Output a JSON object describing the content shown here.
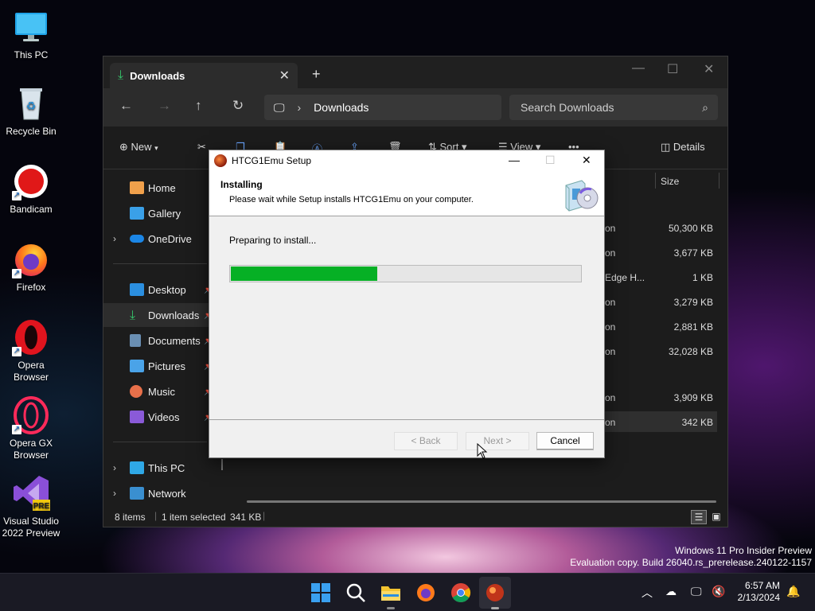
{
  "desktop": {
    "icons": [
      {
        "label": "This PC"
      },
      {
        "label": "Recycle Bin"
      },
      {
        "label": "Bandicam"
      },
      {
        "label": "Firefox"
      },
      {
        "label": "Opera Browser"
      },
      {
        "label": "Opera GX Browser"
      },
      {
        "label": "Visual Studio 2022 Preview",
        "badge": "PRE"
      }
    ]
  },
  "explorer": {
    "tab_label": "Downloads",
    "tab_close": "✕",
    "new_tab": "+",
    "breadcrumb": "Downloads",
    "search_placeholder": "Search Downloads",
    "toolbar": {
      "new_label": "New",
      "sort_label": "Sort",
      "view_label": "View",
      "more": "•••",
      "details_label": "Details"
    },
    "sidebar": {
      "items": [
        {
          "label": "Home"
        },
        {
          "label": "Gallery"
        },
        {
          "label": "OneDrive"
        },
        {
          "label": "Desktop"
        },
        {
          "label": "Downloads"
        },
        {
          "label": "Documents"
        },
        {
          "label": "Pictures"
        },
        {
          "label": "Music"
        },
        {
          "label": "Videos"
        },
        {
          "label": "This PC"
        },
        {
          "label": "Network"
        }
      ]
    },
    "columns": {
      "size": "Size"
    },
    "rows": [
      {
        "frag": "on",
        "size": "50,300 KB"
      },
      {
        "frag": "on",
        "size": "3,677 KB"
      },
      {
        "frag": "Edge H...",
        "size": "1 KB"
      },
      {
        "frag": "on",
        "size": "3,279 KB"
      },
      {
        "frag": "on",
        "size": "2,881 KB"
      },
      {
        "frag": "on",
        "size": "32,028 KB"
      },
      {
        "frag": "on",
        "size": "3,909 KB"
      },
      {
        "frag": "on",
        "size": "342 KB"
      }
    ],
    "status": {
      "items": "8 items",
      "selected": "1 item selected",
      "size": "341 KB"
    }
  },
  "setup": {
    "title": "HTCG1Emu Setup",
    "heading": "Installing",
    "subheading": "Please wait while Setup installs HTCG1Emu on your computer.",
    "status_text": "Preparing to install...",
    "progress": 0.42,
    "buttons": {
      "back": "< Back",
      "next": "Next >",
      "cancel": "Cancel"
    }
  },
  "watermark": {
    "line1": "Windows 11 Pro Insider Preview",
    "line2": "Evaluation copy. Build 26040.rs_prerelease.240122-1157"
  },
  "taskbar": {
    "time": "6:57 AM",
    "date": "2/13/2024"
  },
  "colors": {
    "progress": "#06b025",
    "accent": "#0078d4"
  }
}
